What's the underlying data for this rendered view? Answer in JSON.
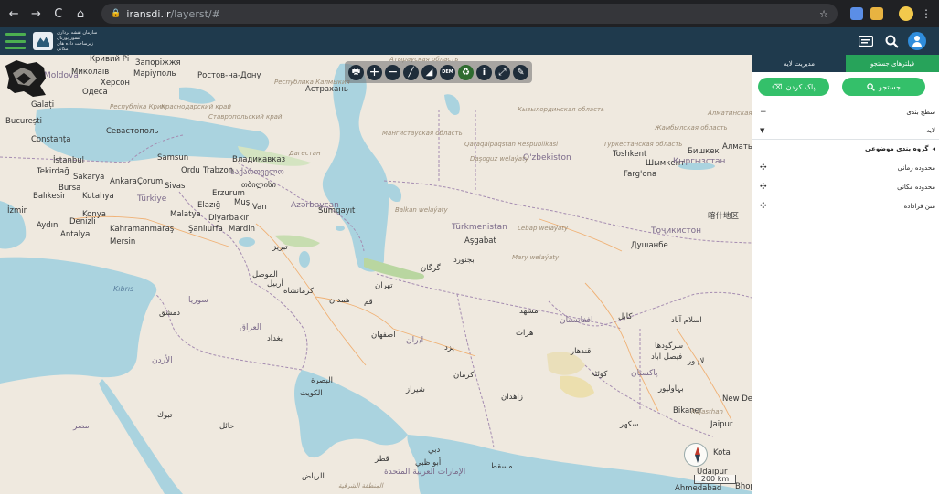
{
  "browser": {
    "url_host": "iransdi.ir",
    "url_path": "/layerst/#"
  },
  "header": {
    "logo_text": "سازمان نقشه برداری کشور پورتال زیرساخت داده های مکانی"
  },
  "map": {
    "labels": {
      "moldova": "Moldova",
      "mykolaiv": "Миколаїв",
      "kryvyi": "Кривий Рі",
      "zaporizhzhia": "Запоріжжя",
      "mariupol": "Маріуполь",
      "rostov": "Ростов-на-Дону",
      "kherson": "Херсон",
      "odesa": "Одеса",
      "galati": "Galați",
      "bucuresti": "București",
      "constanta": "Constanța",
      "sevastopol": "Севастополь",
      "krym": "Республіка Крим",
      "krasnodar": "Краснодарский край",
      "stavropol": "Ставропольский край",
      "kalmykia": "Республика Калмыкия",
      "astrakhan": "Астрахань",
      "atyrau_reg": "Атырауская область",
      "kyzylorda": "Кызылординская область",
      "almatinsk": "Алматинская область",
      "zhambyl": "Жамбылская область",
      "almaty": "Алматы",
      "bishkek": "Бишкек",
      "mangystau": "Мангистауская область",
      "karakalpak": "Qaraqalpaqstan Respublikasi",
      "turkestan": "Туркестанская область",
      "shymkent": "Шымкент",
      "uzbekistan": "O'zbekiston",
      "toshkent": "Toshkent",
      "kyrgyzstan": "Кыргызстан",
      "fargona": "Farg'ona",
      "dagestan": "Дагестан",
      "vladikavkaz": "Владикавказ",
      "sakartvelo": "საქართველო",
      "tbilisi": "თბილისი",
      "azerbaycan": "Azərbaycan",
      "balkan": "Balkan welaýaty",
      "dasoguz": "Daşoguz welaýaty",
      "turkmenistan": "Türkmenistan",
      "lebap": "Lebap welaýaty",
      "mary": "Mary welaýaty",
      "asgabat": "Aşgabat",
      "dushanbe": "Душанбе",
      "tojikiston": "Тоҷикистон",
      "xinjiang": "喀什地区",
      "istanbul": "İstanbul",
      "samsun": "Samsun",
      "tekirdag": "Tekirdağ",
      "sakarya": "Sakarya",
      "ordu": "Ordu",
      "trabzon": "Trabzon",
      "bursa": "Bursa",
      "ankara": "Ankara",
      "corum": "Çorum",
      "sivas": "Sivas",
      "erzurum": "Erzurum",
      "balikesir": "Balıkesir",
      "kutahya": "Kutahya",
      "turkiye": "Türkiye",
      "elazig": "Elazığ",
      "mus": "Muş",
      "van": "Van",
      "izmir": "İzmir",
      "konya": "Konya",
      "malatya": "Malatya",
      "diyarbakir": "Diyarbakır",
      "aydin": "Aydın",
      "denizli": "Denizli",
      "kahramanmaras": "Kahramanmaraş",
      "sanliurfa": "Şanlıurfa",
      "mardin": "Mardin",
      "antalya": "Antalya",
      "mersin": "Mersin",
      "kibris": "Kıbrıs",
      "gorgan": "گرگان",
      "tabriz": "تبریز",
      "tehran": "تهران",
      "qom": "قم",
      "hamedan": "همدان",
      "kermanshah": "کرمانشاه",
      "esfahan": "اصفهان",
      "iran": "ایران",
      "yazd": "یزد",
      "kerman": "کرمان",
      "shiraz": "شیراز",
      "zahedan": "زاهدان",
      "mashhad": "مشهد",
      "bojnurd": "بجنورد",
      "iraq": "العراق",
      "baghdad": "بغداد",
      "basra": "البصرة",
      "kuwait": "الكويت",
      "syria": "سوريا",
      "damascus": "دمشق",
      "jordan": "الأردن",
      "mosul": "الموصل",
      "arbil": "أربيل",
      "afghanistan": "افغانستان",
      "kabul": "کابل",
      "kandahar": "قندهار",
      "herat": "هرات",
      "pakistan": "پاکستان",
      "quetta": "کوئٹہ",
      "faisalabad": "فیصل آباد",
      "lahore": "لاہور",
      "sargodha": "سرگودھا",
      "islamabad": "اسلام آباد",
      "bahawalpur": "بہاولپور",
      "sukkur": "سکھر",
      "new_delhi": "New Del",
      "bikaner": "Bikaner",
      "jaipur": "Jaipur",
      "kota": "Kota",
      "udaipur": "Udaipur",
      "ahmedabad": "Ahmedabad",
      "bhopal": "Bhopa",
      "rajasthan": "Rajasthan",
      "egypt": "مصر",
      "riyadh": "الرياض",
      "tabuk": "تبوك",
      "hail": "حائل",
      "qatar": "قطر",
      "abu_dhabi": "أبو ظبي",
      "dubai": "دبي",
      "oman": "مسقط",
      "uae": "الإمارات العربية المتحدة",
      "sharqiya": "المنطقة الشرقية",
      "sumqayit": "Sumqayıt",
      "caspian_dummy": ""
    }
  },
  "scale": {
    "label": "200 km"
  },
  "sidebar": {
    "tabs": [
      {
        "label": "فیلترهای جستجو"
      },
      {
        "label": "مدیریت لایه"
      }
    ],
    "search_button": "جستجو",
    "clear_button": "پاک کردن",
    "rows": {
      "classification": "سطح بندی",
      "layer": "لایه",
      "thematic_group": "گروه بندی موضوعی",
      "time_range": "محدوده زمانی",
      "spatial_range": "محدوده مکانی",
      "metadata": "متن فراداده"
    }
  },
  "colors": {
    "sea": "#aad3df",
    "land": "#efe9df",
    "header": "#1f3a4d",
    "accent": "#27a35a"
  }
}
